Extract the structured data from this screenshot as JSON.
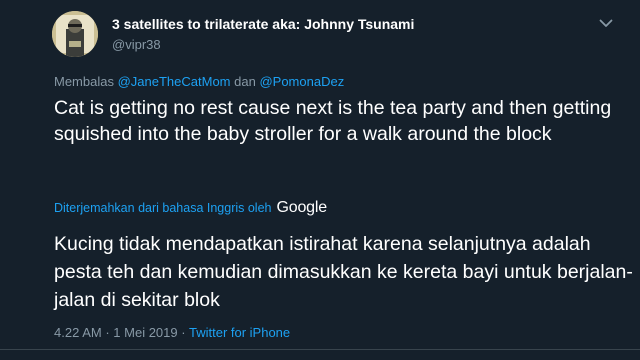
{
  "author": {
    "display_name": "3 satellites to trilaterate aka: Johnny Tsunami",
    "handle": "@vipr38"
  },
  "reply": {
    "prefix": "Membalas",
    "mention_1": "@JaneTheCatMom",
    "joiner": "dan",
    "mention_2": "@PomonaDez"
  },
  "tweet": {
    "text": "Cat is getting no rest cause next is the tea party and then getting squished into the baby stroller for a walk around the block"
  },
  "translation": {
    "label": "Diterjemahkan dari bahasa Inggris oleh",
    "provider": "Google",
    "text": "Kucing tidak mendapatkan istirahat karena selanjutnya adalah pesta teh dan kemudian dimasukkan ke kereta bayi untuk berjalan-jalan di sekitar blok"
  },
  "meta": {
    "time": "4.22 AM",
    "date": "1 Mei 2019",
    "separator": "·",
    "source": "Twitter for iPhone"
  },
  "icons": {
    "more": "chevron-down-icon",
    "avatar": "avatar"
  },
  "colors": {
    "background": "#15202b",
    "text": "#ffffff",
    "secondary": "#8899a6",
    "accent": "#1da1f2"
  }
}
